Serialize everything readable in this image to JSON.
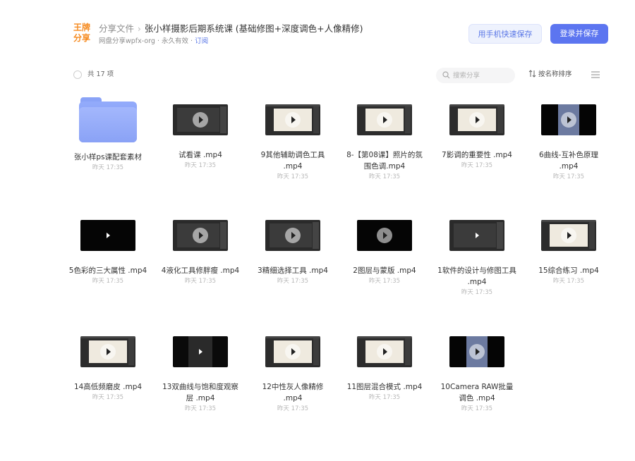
{
  "logo": {
    "line1": "王牌",
    "line2": "分享"
  },
  "breadcrumb": {
    "root": "分享文件",
    "separator": "›",
    "title": "张小样摄影后期系统课 (基础修图+深度调色+人像精修)"
  },
  "meta": {
    "source": "网盘分享wpfx-org · 永久有效 · ",
    "subscribe": "订阅"
  },
  "buttons": {
    "phone_save": "用手机快速保存",
    "login_save": "登录并保存"
  },
  "toolbar": {
    "count": "共 17 项",
    "search_placeholder": "搜索分享",
    "sort_label": "按名称排序"
  },
  "colors": {
    "accent": "#5c75f0",
    "logo": "#f58a1f",
    "folder": "#8aa3f7"
  },
  "items": [
    {
      "name": "张小样ps课配套素材",
      "time": "昨天 17:35",
      "type": "folder"
    },
    {
      "name": "试看课 .mp4",
      "time": "昨天 17:35",
      "type": "video"
    },
    {
      "name": "9其他辅助调色工具 .mp4",
      "time": "昨天 17:35",
      "type": "video"
    },
    {
      "name": "8-【第08课】照片的氛围色调.mp4",
      "time": "昨天 17:35",
      "type": "video"
    },
    {
      "name": "7影调的重要性 .mp4",
      "time": "昨天 17:35",
      "type": "video"
    },
    {
      "name": "6曲线-互补色原理 .mp4",
      "time": "昨天 17:35",
      "type": "video"
    },
    {
      "name": "5色彩的三大属性 .mp4",
      "time": "昨天 17:35",
      "type": "video"
    },
    {
      "name": "4液化工具修胖瘦 .mp4",
      "time": "昨天 17:35",
      "type": "video"
    },
    {
      "name": "3精细选择工具 .mp4",
      "time": "昨天 17:35",
      "type": "video"
    },
    {
      "name": "2图层与蒙版 .mp4",
      "time": "昨天 17:35",
      "type": "video"
    },
    {
      "name": "1软件的设计与修图工具 .mp4",
      "time": "昨天 17:35",
      "type": "video"
    },
    {
      "name": "15综合练习 .mp4",
      "time": "昨天 17:35",
      "type": "video"
    },
    {
      "name": "14高低频磨皮 .mp4",
      "time": "昨天 17:35",
      "type": "video"
    },
    {
      "name": "13双曲线与饱和度观察层 .mp4",
      "time": "昨天 17:35",
      "type": "video"
    },
    {
      "name": "12中性灰人像精修 .mp4",
      "time": "昨天 17:35",
      "type": "video"
    },
    {
      "name": "11图层混合模式 .mp4",
      "time": "昨天 17:35",
      "type": "video"
    },
    {
      "name": "10Camera RAW批量调色 .mp4",
      "time": "昨天 17:35",
      "type": "video"
    }
  ]
}
